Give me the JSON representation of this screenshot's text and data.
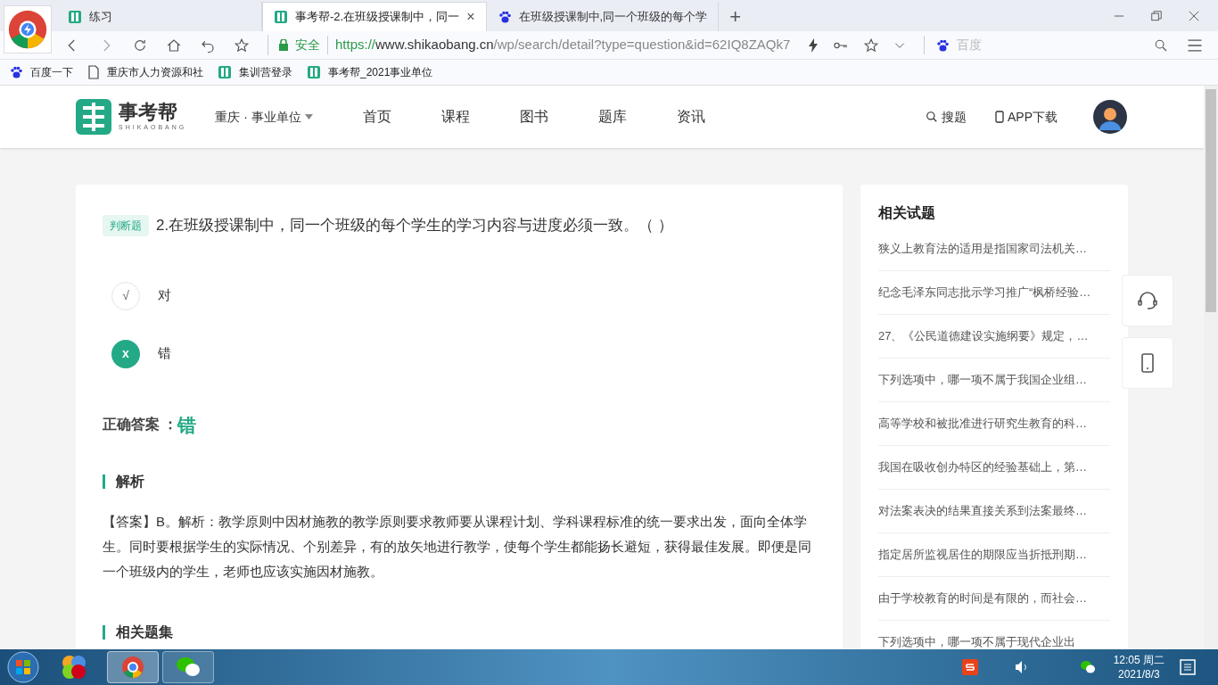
{
  "browser": {
    "tabs": [
      {
        "title": "练习",
        "selected": false
      },
      {
        "title": "事考帮-2.在班级授课制中，同一",
        "selected": true,
        "close": "×"
      },
      {
        "title": "在班级授课制中,同一个班级的每个学",
        "selected": false
      }
    ],
    "new_tab": "+",
    "address": {
      "secure_label": "安全",
      "scheme": "https://",
      "host": "www.shikaobang.cn",
      "path": "/wp/search/detail?type=question&id=62IQ8ZAQk7"
    },
    "search_placeholder": "百度",
    "bookmarks": [
      "百度一下",
      "重庆市人力资源和社",
      "集训营登录",
      "事考帮_2021事业单位"
    ]
  },
  "site": {
    "logo_text": "事考帮",
    "logo_sub": "SHIKAOBANG",
    "region": "重庆 · 事业单位",
    "nav": [
      {
        "label": "首页",
        "selected": false
      },
      {
        "label": "课程",
        "selected": false
      },
      {
        "label": "图书",
        "selected": false
      },
      {
        "label": "题库",
        "selected": false
      },
      {
        "label": "资讯",
        "selected": false
      }
    ],
    "search_link": "搜题",
    "app_link": "APP下载"
  },
  "question": {
    "tag": "判断题",
    "text": "2.在班级授课制中，同一个班级的每个学生的学习内容与进度必须一致。（   ）",
    "options": [
      {
        "mark": "√",
        "label": "对",
        "selected": false
      },
      {
        "mark": "x",
        "label": "错",
        "selected": true
      }
    ],
    "answer_label": "正确答案 ：",
    "answer": "错",
    "analysis_title": "解析",
    "analysis": "【答案】B。解析：教学原则中因材施教的教学原则要求教师要从课程计划、学科课程标准的统一要求出发，面向全体学生。同时要根据学生的实际情况、个别差异，有的放矢地进行教学，使每个学生都能扬长避短，获得最佳发展。即便是同一个班级内的学生，老师也应该实施因材施教。",
    "related_sets_title": "相关题集"
  },
  "related": {
    "title": "相关试题",
    "items": [
      "狭义上教育法的适用是指国家司法机关…",
      "纪念毛泽东同志批示学习推广“枫桥经验…",
      "27、《公民道德建设实施纲要》规定，…",
      "下列选项中，哪一项不属于我国企业组…",
      "高等学校和被批准进行研究生教育的科…",
      "我国在吸收创办特区的经验基础上，第…",
      "对法案表决的结果直接关系到法案最终…",
      "指定居所监视居住的期限应当折抵刑期…",
      "由于学校教育的时间是有限的，而社会…",
      "下列选项中，哪一项不属于现代企业出"
    ]
  },
  "taskbar": {
    "time": "12:05 周二",
    "date": "2021/8/3"
  }
}
